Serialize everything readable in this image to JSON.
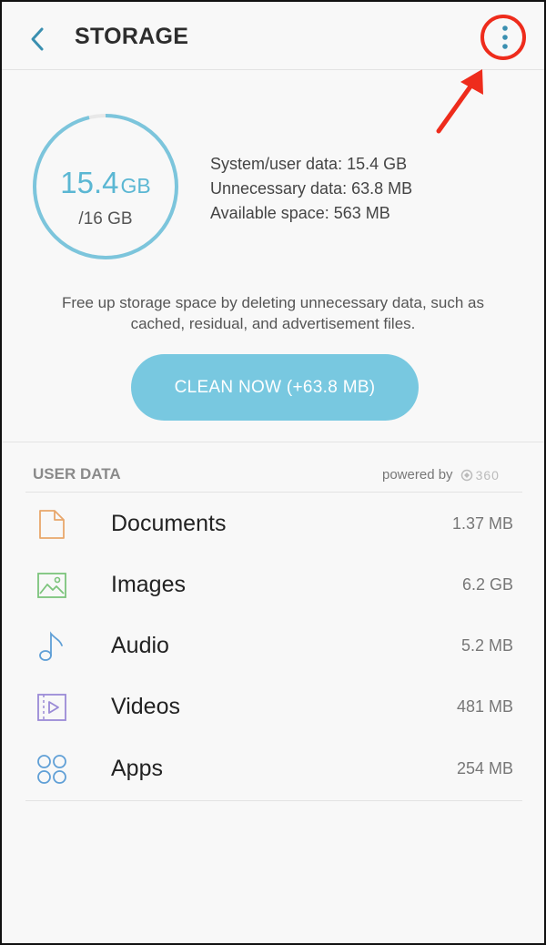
{
  "header": {
    "title": "STORAGE"
  },
  "summary": {
    "used_value": "15.4",
    "used_unit": "GB",
    "total": "/16 GB",
    "used_fraction": 0.9625,
    "stats": [
      "System/user data: 15.4 GB",
      "Unnecessary data: 63.8 MB",
      "Available space: 563 MB"
    ],
    "description_line1": "Free up storage space by deleting unnecessary data, such as",
    "description_line2": "cached, residual, and advertisement files.",
    "clean_button": "CLEAN NOW (+63.8 MB)"
  },
  "user_data": {
    "heading": "USER DATA",
    "powered_by": "powered by",
    "brand": "360",
    "items": [
      {
        "label": "Documents",
        "size": "1.37 MB",
        "icon": "document-icon"
      },
      {
        "label": "Images",
        "size": "6.2 GB",
        "icon": "image-icon"
      },
      {
        "label": "Audio",
        "size": "5.2 MB",
        "icon": "audio-icon"
      },
      {
        "label": "Videos",
        "size": "481 MB",
        "icon": "video-icon"
      },
      {
        "label": "Apps",
        "size": "254 MB",
        "icon": "apps-icon"
      }
    ]
  },
  "colors": {
    "accent": "#78c8e0",
    "ring": "#7cc5dc",
    "annotation": "#ee2c1c",
    "document_icon": "#e8a76b",
    "image_icon": "#7cc47c",
    "audio_icon": "#5f9fd6",
    "video_icon": "#9a8ad6",
    "apps_icon": "#5f9fd6"
  }
}
